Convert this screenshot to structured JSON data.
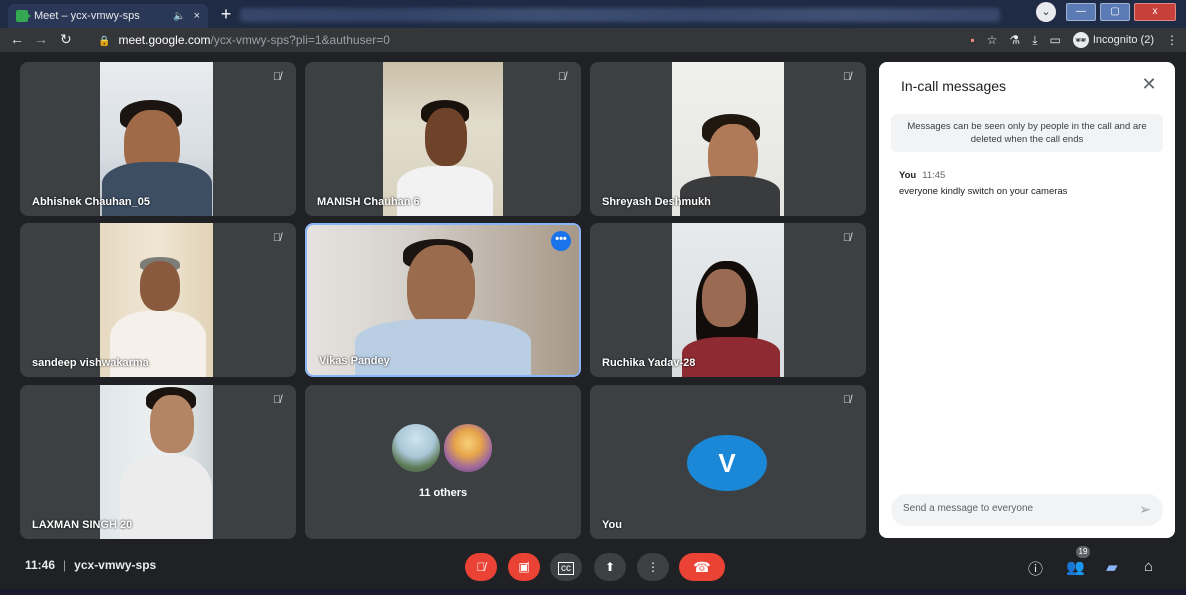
{
  "browser": {
    "tab_title": "Meet – ycx-vmwy-sps",
    "tab_close": "×",
    "new_tab": "+",
    "url_host": "meet.google.com",
    "url_path": "/ycx-vmwy-sps?pli=1&authuser=0",
    "incognito_label": "Incognito (2)",
    "window_buttons": {
      "minimize": "—",
      "maximize": "▢",
      "close": "x"
    }
  },
  "tiles": [
    {
      "name": "Abhishek Chauhan_05",
      "mic_muted": true
    },
    {
      "name": "MANISH Chauhan 6",
      "mic_muted": true
    },
    {
      "name": "Shreyash Deshmukh",
      "mic_muted": true
    },
    {
      "name": "sandeep vishwakarma",
      "mic_muted": true
    },
    {
      "name": "Vikas Pandey",
      "mic_muted": false,
      "active": true,
      "more": "•••"
    },
    {
      "name": "Ruchika Yadav-28",
      "mic_muted": true
    },
    {
      "name": "LAXMAN SINGH 20",
      "mic_muted": true
    },
    {
      "name": "11 others"
    },
    {
      "name": "You",
      "avatar_letter": "V",
      "mic_muted": true
    }
  ],
  "panel": {
    "title": "In-call messages",
    "close": "✕",
    "notice": "Messages can be seen only by people in the call and are deleted when the call ends",
    "message": {
      "sender": "You",
      "time": "11:45",
      "text": "everyone kindly switch on your cameras"
    },
    "input_placeholder": "Send a message to everyone"
  },
  "bottom_bar": {
    "time": "11:46",
    "meeting_code": "ycx-vmwy-sps",
    "participants_count": "19"
  },
  "colors": {
    "accent": "#1a73e8",
    "danger": "#ea4335",
    "background": "#202124",
    "tile": "#3c4043"
  }
}
